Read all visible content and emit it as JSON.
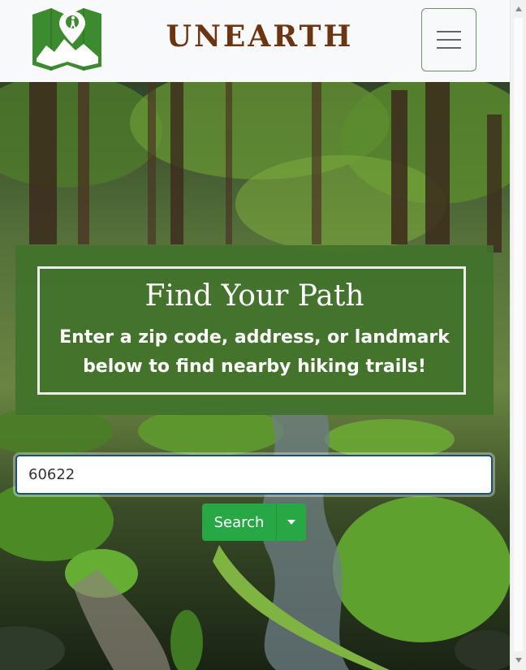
{
  "navbar": {
    "brand": "UNEARTH",
    "logo_icon": "trail-map-hiker-icon",
    "menu_icon": "hamburger-menu-icon"
  },
  "hero": {
    "title": "Find Your Path",
    "subtitle": "Enter a zip code, address, or landmark below to find nearby hiking trails!"
  },
  "search": {
    "value": "60622",
    "button_label": "Search",
    "dropdown_icon": "caret-down-icon"
  },
  "colors": {
    "brand": "#6b3512",
    "panel_green": "#40722a",
    "button_green": "#28a745",
    "logo_green": "#3d8b2f"
  }
}
